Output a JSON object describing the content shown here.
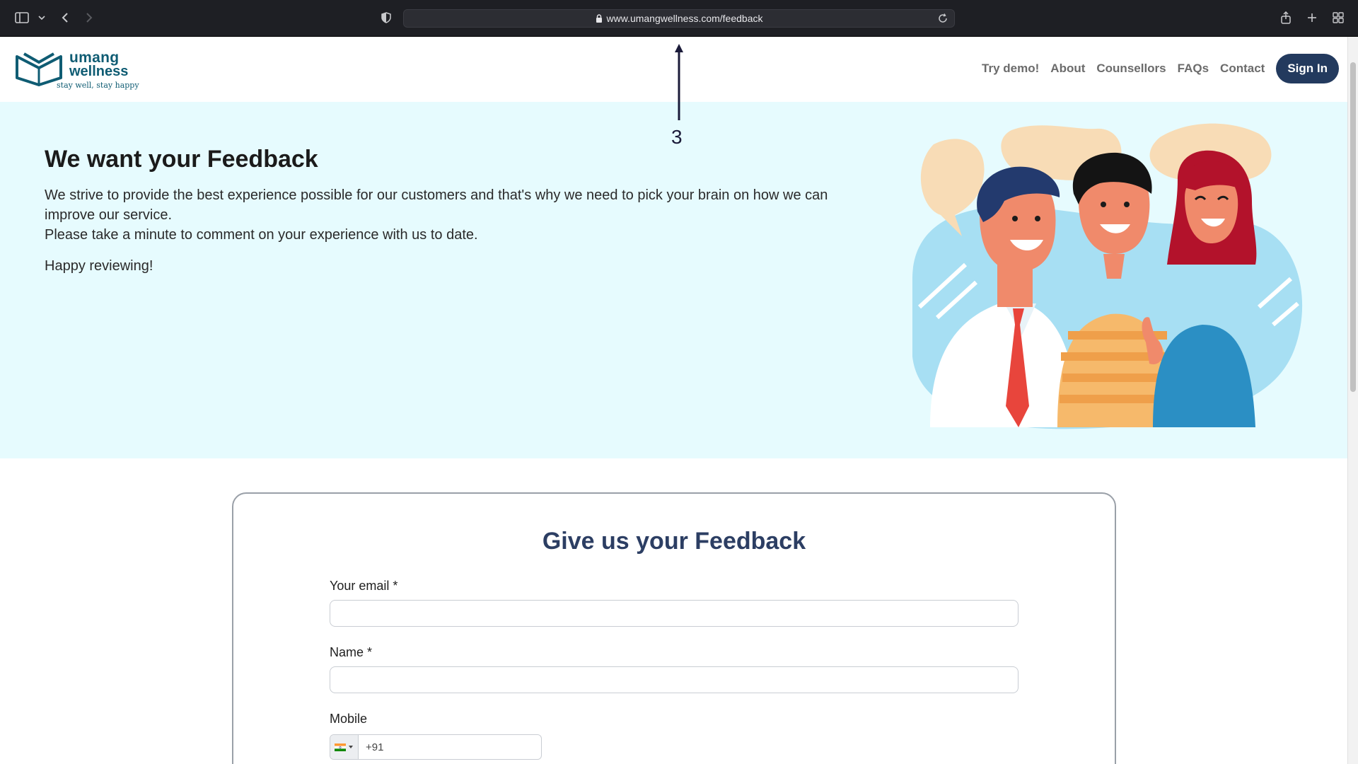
{
  "browser": {
    "url": "www.umangwellness.com/feedback"
  },
  "header": {
    "logo": {
      "brand_line1": "umang",
      "brand_line2": "wellness",
      "tagline": "stay well, stay happy"
    },
    "nav": [
      {
        "label": "Try demo!"
      },
      {
        "label": "About"
      },
      {
        "label": "Counsellors"
      },
      {
        "label": "FAQs"
      },
      {
        "label": "Contact"
      }
    ],
    "signin_label": "Sign In"
  },
  "annotation": {
    "number": "3"
  },
  "hero": {
    "title": "We want your Feedback",
    "paragraph_line1": "We strive to provide the best experience possible for our customers and that's why we need to pick your brain on how we can improve our service.",
    "paragraph_line2": "Please take a minute to comment on your experience with us to date.",
    "closing": "Happy reviewing!"
  },
  "form": {
    "title": "Give us your Feedback",
    "email_label": "Your email *",
    "email_value": "",
    "name_label": "Name *",
    "name_value": "",
    "mobile_label": "Mobile",
    "mobile_code": "+91"
  },
  "colors": {
    "brand": "#0f5c73",
    "signin_bg": "#233a5e",
    "hero_bg": "#e6fbfe",
    "form_title": "#2c3e63"
  }
}
